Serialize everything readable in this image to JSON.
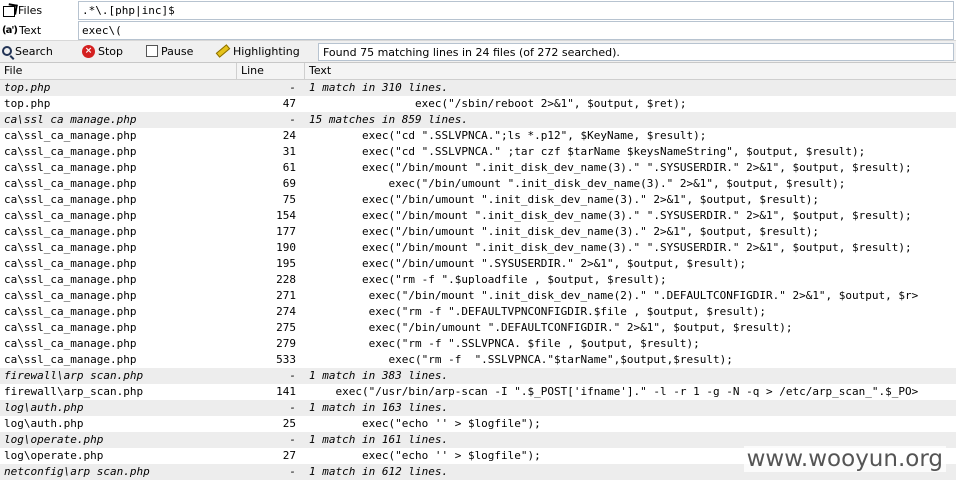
{
  "files_row": {
    "label": "Files",
    "value": ".*\\.[php|inc]$"
  },
  "text_row": {
    "label": "Text",
    "icon_text": "(a')",
    "value": "exec\\("
  },
  "toolbar": {
    "search_label": "Search",
    "stop_label": "Stop",
    "pause_label": "Pause",
    "highlight_label": "Highlighting",
    "status": "Found 75 matching lines in 24 files (of 272 searched)."
  },
  "columns": {
    "file": "File",
    "line": "Line",
    "text": "Text"
  },
  "rows": [
    {
      "g": true,
      "file": "top.php",
      "line": "-",
      "text": "1 match in 310 lines."
    },
    {
      "g": false,
      "file": "top.php",
      "line": "47",
      "text": "                exec(\"/sbin/reboot 2>&1\", $output, $ret);"
    },
    {
      "g": true,
      "file": "ca\\ssl ca manage.php",
      "line": "-",
      "text": "15 matches in 859 lines."
    },
    {
      "g": false,
      "file": "ca\\ssl_ca_manage.php",
      "line": "24",
      "text": "        exec(\"cd \".SSLVPNCA.\";ls *.p12\", $KeyName, $result);"
    },
    {
      "g": false,
      "file": "ca\\ssl_ca_manage.php",
      "line": "31",
      "text": "        exec(\"cd \".SSLVPNCA.\" ;tar czf $tarName $keysNameString\", $output, $result);"
    },
    {
      "g": false,
      "file": "ca\\ssl_ca_manage.php",
      "line": "61",
      "text": "        exec(\"/bin/mount \".init_disk_dev_name(3).\" \".SYSUSERDIR.\" 2>&1\", $output, $result);"
    },
    {
      "g": false,
      "file": "ca\\ssl_ca_manage.php",
      "line": "69",
      "text": "            exec(\"/bin/umount \".init_disk_dev_name(3).\" 2>&1\", $output, $result);"
    },
    {
      "g": false,
      "file": "ca\\ssl_ca_manage.php",
      "line": "75",
      "text": "        exec(\"/bin/umount \".init_disk_dev_name(3).\" 2>&1\", $output, $result);"
    },
    {
      "g": false,
      "file": "ca\\ssl_ca_manage.php",
      "line": "154",
      "text": "        exec(\"/bin/mount \".init_disk_dev_name(3).\" \".SYSUSERDIR.\" 2>&1\", $output, $result);"
    },
    {
      "g": false,
      "file": "ca\\ssl_ca_manage.php",
      "line": "177",
      "text": "        exec(\"/bin/umount \".init_disk_dev_name(3).\" 2>&1\", $output, $result);"
    },
    {
      "g": false,
      "file": "ca\\ssl_ca_manage.php",
      "line": "190",
      "text": "        exec(\"/bin/mount \".init_disk_dev_name(3).\" \".SYSUSERDIR.\" 2>&1\", $output, $result);"
    },
    {
      "g": false,
      "file": "ca\\ssl_ca_manage.php",
      "line": "195",
      "text": "        exec(\"/bin/umount \".SYSUSERDIR.\" 2>&1\", $output, $result);"
    },
    {
      "g": false,
      "file": "ca\\ssl_ca_manage.php",
      "line": "228",
      "text": "        exec(\"rm -f \".$uploadfile , $output, $result);"
    },
    {
      "g": false,
      "file": "ca\\ssl_ca_manage.php",
      "line": "271",
      "text": "         exec(\"/bin/mount \".init_disk_dev_name(2).\" \".DEFAULTCONFIGDIR.\" 2>&1\", $output, $r>"
    },
    {
      "g": false,
      "file": "ca\\ssl_ca_manage.php",
      "line": "274",
      "text": "         exec(\"rm -f \".DEFAULTVPNCONFIGDIR.$file , $output, $result);"
    },
    {
      "g": false,
      "file": "ca\\ssl_ca_manage.php",
      "line": "275",
      "text": "         exec(\"/bin/umount \".DEFAULTCONFIGDIR.\" 2>&1\", $output, $result);"
    },
    {
      "g": false,
      "file": "ca\\ssl_ca_manage.php",
      "line": "279",
      "text": "         exec(\"rm -f \".SSLVPNCA. $file , $output, $result);"
    },
    {
      "g": false,
      "file": "ca\\ssl_ca_manage.php",
      "line": "533",
      "text": "            exec(\"rm -f  \".SSLVPNCA.\"$tarName\",$output,$result);"
    },
    {
      "g": true,
      "file": "firewall\\arp scan.php",
      "line": "-",
      "text": "1 match in 383 lines."
    },
    {
      "g": false,
      "file": "firewall\\arp_scan.php",
      "line": "141",
      "text": "    exec(\"/usr/bin/arp-scan -I \".$_POST['ifname'].\" -l -r 1 -g -N -q > /etc/arp_scan_\".$_PO>"
    },
    {
      "g": true,
      "file": "log\\auth.php",
      "line": "-",
      "text": "1 match in 163 lines."
    },
    {
      "g": false,
      "file": "log\\auth.php",
      "line": "25",
      "text": "        exec(\"echo '' > $logfile\");"
    },
    {
      "g": true,
      "file": "log\\operate.php",
      "line": "-",
      "text": "1 match in 161 lines."
    },
    {
      "g": false,
      "file": "log\\operate.php",
      "line": "27",
      "text": "        exec(\"echo '' > $logfile\");"
    },
    {
      "g": true,
      "file": "netconfig\\arp scan.php",
      "line": "-",
      "text": "1 match in 612 lines."
    }
  ],
  "watermark": "www.wooyun.org",
  "colors": {
    "group_bg": "#ededed",
    "header_bg": "#f4f4f4",
    "toolbar_bg": "#f0f0f0",
    "stop_red": "#d42020"
  }
}
